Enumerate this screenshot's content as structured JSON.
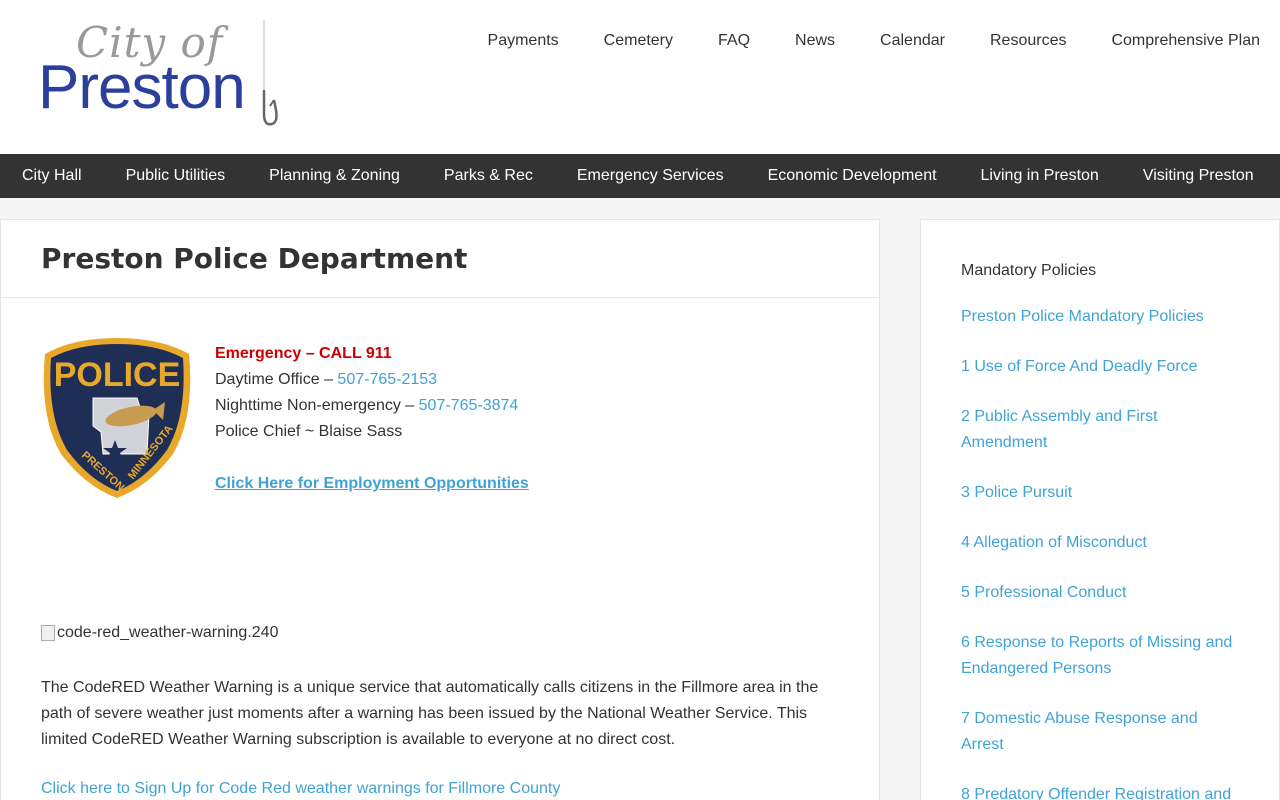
{
  "logo": {
    "city_text": "City of",
    "name_text": "Preston"
  },
  "top_nav": [
    "Payments",
    "Cemetery",
    "FAQ",
    "News",
    "Calendar",
    "Resources",
    "Comprehensive Plan"
  ],
  "main_nav": [
    "City Hall",
    "Public Utilities",
    "Planning & Zoning",
    "Parks & Rec",
    "Emergency Services",
    "Economic Development",
    "Living in Preston",
    "Visiting Preston"
  ],
  "page": {
    "title": "Preston Police Department",
    "badge": {
      "top": "POLICE",
      "left_arc": "PRESTON",
      "right_arc": "MINNESOTA"
    },
    "contact": {
      "emergency": "Emergency – CALL 911",
      "day_label": "Daytime Office – ",
      "day_phone": "507-765-2153",
      "night_label": "Nighttime Non-emergency – ",
      "night_phone": "507-765-3874",
      "chief": "Police Chief ~ Blaise Sass",
      "employment": "Click Here for Employment Opportunities"
    },
    "broken_image_alt": "code-red_weather-warning.240",
    "codered_text": "The CodeRED Weather Warning is a unique service that automatically calls citizens in the Fillmore area in the path of severe weather just moments after a warning has been issued by the National Weather Service. This limited CodeRED Weather Warning subscription is available to everyone at no direct cost.",
    "codered_link": "Click here to Sign Up for Code Red weather warnings for Fillmore County"
  },
  "sidebar": {
    "title": "Mandatory Policies",
    "items": [
      "Preston Police Mandatory Policies",
      "1 Use of Force And Deadly Force",
      "2 Public Assembly and First Amendment",
      "3 Police Pursuit",
      "4 Allegation of Misconduct",
      "5 Professional Conduct",
      "6 Response to Reports of Missing and Endangered Persons",
      "7 Domestic Abuse Response and Arrest",
      "8 Predatory Offender Registration and"
    ]
  },
  "colors": {
    "brand_blue": "#2b3f9c",
    "link_blue": "#3fa3d6",
    "emergency_red": "#cc0000",
    "nav_bg": "#333333"
  }
}
